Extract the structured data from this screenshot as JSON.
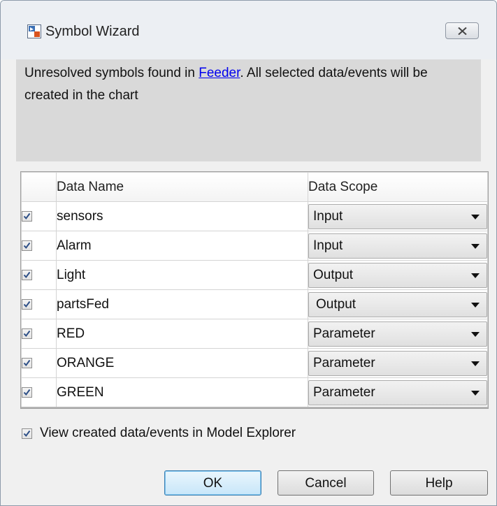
{
  "window": {
    "title": "Symbol Wizard",
    "icon": "simulink-chart-icon",
    "close_icon": "close-icon"
  },
  "info": {
    "prefix": "Unresolved symbols found in ",
    "link": "Feeder",
    "suffix": ". All selected data/events will be created in the chart"
  },
  "table": {
    "headers": {
      "check": "",
      "name": "Data Name",
      "scope": "Data Scope"
    },
    "rows": [
      {
        "checked": true,
        "name": "sensors",
        "scope": "Input"
      },
      {
        "checked": true,
        "name": "Alarm",
        "scope": "Input"
      },
      {
        "checked": true,
        "name": "Light",
        "scope": "Output"
      },
      {
        "checked": true,
        "name": "partsFed",
        "scope": "Output"
      },
      {
        "checked": true,
        "name": "RED",
        "scope": "Parameter"
      },
      {
        "checked": true,
        "name": "ORANGE",
        "scope": "Parameter"
      },
      {
        "checked": true,
        "name": "GREEN",
        "scope": "Parameter"
      }
    ]
  },
  "options": {
    "view_in_explorer_label": "View created data/events in Model Explorer",
    "view_in_explorer_checked": true
  },
  "buttons": {
    "ok": "OK",
    "cancel": "Cancel",
    "help": "Help"
  },
  "colors": {
    "link": "#0000ee",
    "info_panel": "#d9d9d9",
    "check_mark": "#2c4e86"
  }
}
